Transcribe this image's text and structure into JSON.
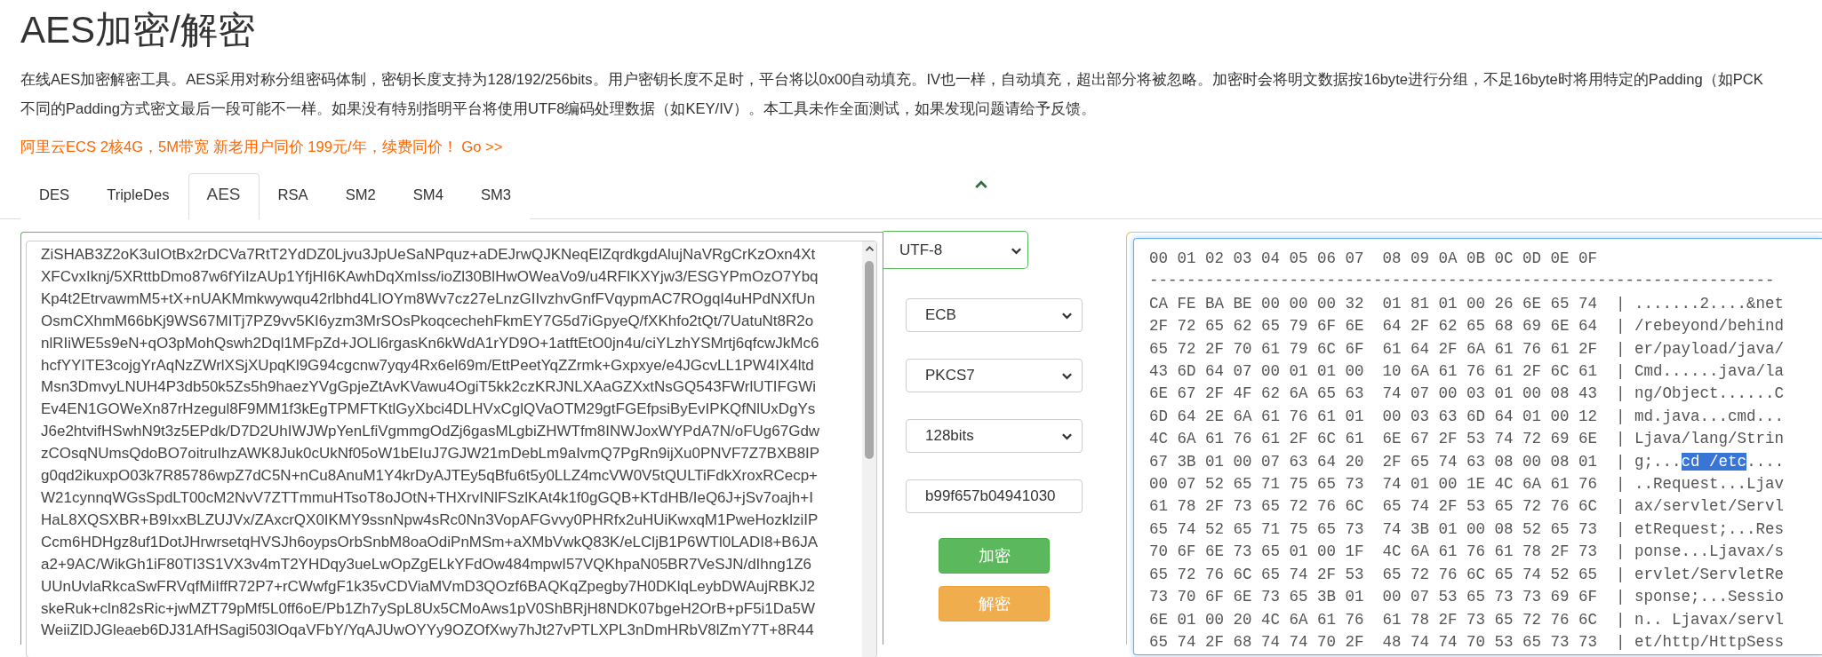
{
  "page": {
    "title": "AES加密/解密",
    "description": [
      "在线AES加密解密工具。AES采用对称分组密码体制，密钥长度支持为128/192/256bits。用户密钥长度不足时，平台将以0x00自动填充。IV也一样，自动填充，超出部分将被忽略。加密时会将明文数据按16byte进行分组，不足16byte时将用特定的Padding（如PCK",
      "不同的Padding方式密文最后一段可能不一样。如果没有特别指明平台将使用UTF8编码处理数据（如KEY/IV）。本工具未作全面测试，如果发现问题请给予反馈。"
    ],
    "promo": "阿里云ECS 2核4G，5M带宽 新老用户同价 199元/年，续费同价！ Go >>"
  },
  "tabs": [
    {
      "label": "DES",
      "selected": false
    },
    {
      "label": "TripleDes",
      "selected": false
    },
    {
      "label": "AES",
      "selected": true
    },
    {
      "label": "RSA",
      "selected": false
    },
    {
      "label": "SM2",
      "selected": false
    },
    {
      "label": "SM4",
      "selected": false
    },
    {
      "label": "SM3",
      "selected": false
    }
  ],
  "input": {
    "lines": [
      "ZiSHAB3Z2oK3uIOtBx2rDCVa7RtT2YdDZ0Ljvu3JpUeSaNPquz+aDEJrwQJKNeqElZqrdkgdAlujNaVRgCrKzOxn4Xt",
      "XFCvxIknj/5XRttbDmo87w6fYiIzAUp1YfjHI6KAwhDqXmIss/ioZl30BlHwOWeaVo9/u4RFlKXYjw3/ESGYPmOzO7Ybq",
      "Kp4t2EtrvawmM5+tX+nUAKMmkwywqu42rlbhd4LIOYm8Wv7cz27eLnzGIIvzhvGnfFVqypmAC7ROgqI4uHPdNXfUn",
      "OsmCXhmM66bKj9WS67MITj7PZ9vv5KI6yzm3MrSOsPkoqcechehFkmEY7G5d7iGpyeQ/fXKhfo2tQt/7UatuNt8R2o",
      "nlRIiWE5s9eN+qO3pMohQswh2Dql1MFpZd+JOLl6rgasKn6kWdA1rYD9O+1atftEtO0jn4u/ciYLzhYSMrtj6qfcwJkMc6",
      "hcfYYITE3cojgYrAqNzZWrlXSjXUpqKl9G94cgcnw7yqy4Rx6el69m/EttPeetYqZZrmk+Gxpxye/e4JGcvLL1PW4IX4ltd",
      "Msn3DmvyLNUH4P3db50k5Zs5h9haezYVgGpjeZtAvKVawu4OgiT5kk2czKRJNLXAaGZXxtNsGQ543FWrlUTIFGWi",
      "Ev4EN1GOWeXn87rHzegul8F9MM1f3kEgTPMFTKtlGyXbci4DLHVxCglQVaOTM29gtFGEfpsiByEvIPKQfNlUxDgYs",
      "J6e2htvifHSwhN9t3z5EPdk/D7D2UhIWJWpYenLfiVgmmgOdZj6gasMLgbiZHWTfm8INWJoxWYPdA7N/oFUg67Gdw",
      "zCOsqNUmsQdoBO7oitruIhzAWK8Juk0cUkNf05oW1bEIuJ7GJW21mDebLm9aIvmQ7PgRn9ijXu0PNVF7Z7BXB8IP",
      "g0qd2ikuxpO03k7R85786wpZ7dC5N+nCu8AnuM1Y4krDyAJTEy5qBfu6t5y0LLZ4mcVW0V5tQULTiFdkXroxRCecp+",
      "W21cynnqWGsSpdLT00cM2NvV7ZTTmmuHTsoT8oJOtN+THXrvINlFSzlKAt4k1f0gGQB+KTdHB/IeQ6J+jSv7oajh+I",
      "HaL8XQSXBR+B9IxxBLZUJVx/ZAxcrQX0IKMY9ssnNpw4sRc0Nn3VopAFGvvy0PHRfx2uHUiKwxqM1PweHozklziIP",
      "Ccm6HDHgz8uf1DotJHrwrsetqHVSJh6oypsOrbSnbM8oaOdiPnMSm+aXMbVwkQ83K/eLCljB1P6WTl0LADI8+B6JA",
      "a2+9AC/WikGh1iF80TI3S1VX3v4mT2YHDqy3ueLwOpZgELkYFdOw484mpwI57VQKhpaN05BR7VeSJN/dIhng1Z6",
      "UUnUvlaRkcaSwFRVqfMiIffR72P7+rCWwfgF1k35vCDViaMVmD3QOzf6BAQKqZpegby7H0DKlqLeybDWAujRBKJ2",
      "skeRuk+cln82sRic+jwMZT79pMf5L0ff6oE/Pb1Zh7ySpL8Ux5CMoAws1pV0ShBRjH8NDK07bgeH2OrB+pF5i1Da5W",
      "WeiiZlDJGleaeb6DJ31AfHSagi503lOqaVFbY/YqAJUwOYYy9OZOfXwy7hJt27vPTLXPL3nDmHRbV8lZmY7T+8R44"
    ]
  },
  "encoding": {
    "value": "UTF-8"
  },
  "options": [
    {
      "kind": "select",
      "value": "ECB"
    },
    {
      "kind": "select",
      "value": "PKCS7"
    },
    {
      "kind": "select",
      "value": "128bits"
    },
    {
      "kind": "input",
      "value": "b99f657b04941030"
    }
  ],
  "buttons": [
    {
      "label": "加密",
      "kind": "success"
    },
    {
      "label": "解密",
      "kind": "warning"
    }
  ],
  "hex": {
    "header": "00 01 02 03 04 05 06 07  08 09 0A 0B 0C 0D 0E 0F",
    "separator": "-------------------------------------------------------------------",
    "rows": [
      {
        "segments": [
          {
            "text": "CA FE BA BE 00 00 00 32  01 81 01 00 26 6E 65 74  | .......2....&net",
            "selected": false
          }
        ]
      },
      {
        "segments": [
          {
            "text": "2F 72 65 62 65 79 6F 6E  64 2F 62 65 68 69 6E 64  | /rebeyond/behind",
            "selected": false
          }
        ]
      },
      {
        "segments": [
          {
            "text": "65 72 2F 70 61 79 6C 6F  61 64 2F 6A 61 76 61 2F  | er/payload/java/",
            "selected": false
          }
        ]
      },
      {
        "segments": [
          {
            "text": "43 6D 64 07 00 01 01 00  10 6A 61 76 61 2F 6C 61  | Cmd......java/la",
            "selected": false
          }
        ]
      },
      {
        "segments": [
          {
            "text": "6E 67 2F 4F 62 6A 65 63  74 07 00 03 01 00 08 43  | ng/Object......C",
            "selected": false
          }
        ]
      },
      {
        "segments": [
          {
            "text": "6D 64 2E 6A 61 76 61 01  00 03 63 6D 64 01 00 12  | md.java...cmd...",
            "selected": false
          }
        ]
      },
      {
        "segments": [
          {
            "text": "4C 6A 61 76 61 2F 6C 61  6E 67 2F 53 74 72 69 6E  | Ljava/lang/Strin",
            "selected": false
          }
        ]
      },
      {
        "segments": [
          {
            "text": "67 3B 01 00 07 63 64 20  2F 65 74 63 08 00 08 01  | g;...",
            "selected": false
          },
          {
            "text": "cd /etc",
            "selected": true
          },
          {
            "text": "....",
            "selected": false
          }
        ]
      },
      {
        "segments": [
          {
            "text": "00 07 52 65 71 75 65 73  74 01 00 1E 4C 6A 61 76  | ..Request...Ljav",
            "selected": false
          }
        ]
      },
      {
        "segments": [
          {
            "text": "61 78 2F 73 65 72 76 6C  65 74 2F 53 65 72 76 6C  | ax/servlet/Servl",
            "selected": false
          }
        ]
      },
      {
        "segments": [
          {
            "text": "65 74 52 65 71 75 65 73  74 3B 01 00 08 52 65 73  | etRequest;...Res",
            "selected": false
          }
        ]
      },
      {
        "segments": [
          {
            "text": "70 6F 6E 73 65 01 00 1F  4C 6A 61 76 61 78 2F 73  | ponse...Ljavax/s",
            "selected": false
          }
        ]
      },
      {
        "segments": [
          {
            "text": "65 72 76 6C 65 74 2F 53  65 72 76 6C 65 74 52 65  | ervlet/ServletRe",
            "selected": false
          }
        ]
      },
      {
        "segments": [
          {
            "text": "73 70 6F 6E 73 65 3B 01  00 07 53 65 73 73 69 6F  | sponse;...Sessio",
            "selected": false
          }
        ]
      },
      {
        "segments": [
          {
            "text": "6E 01 00 20 4C 6A 61 76  61 78 2F 73 65 72 76 6C  | n.. Ljavax/servl",
            "selected": false
          }
        ]
      },
      {
        "segments": [
          {
            "text": "65 74 2F 68 74 74 70 2F  48 74 74 70 53 65 73 73  | et/http/HttpSess",
            "selected": false
          }
        ]
      }
    ]
  }
}
